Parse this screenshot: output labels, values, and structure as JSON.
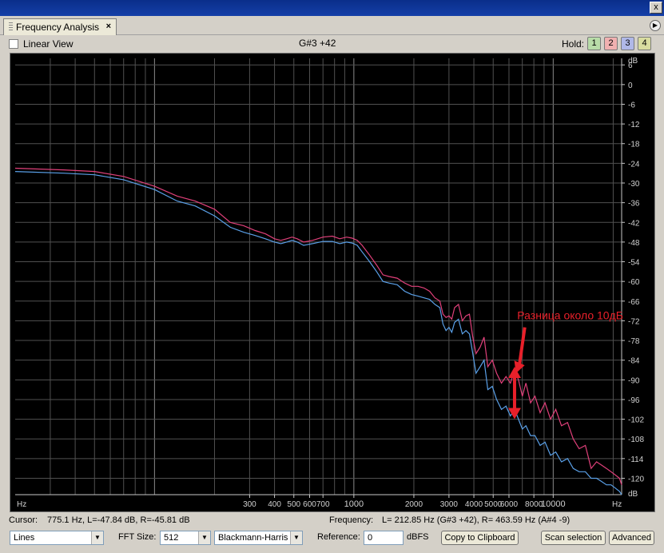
{
  "window": {
    "close_label": "x"
  },
  "tab": {
    "label": "Frequency Analysis",
    "close_label": "×"
  },
  "panel_menu_icon": "▶",
  "toolbar": {
    "linear_view_label": "Linear View",
    "linear_view_checked": false,
    "note": "G#3 +42",
    "hold_label": "Hold:",
    "hold_buttons": [
      {
        "label": "1",
        "color": "#b8dca8"
      },
      {
        "label": "2",
        "color": "#f0b0b0"
      },
      {
        "label": "3",
        "color": "#b0b8e8"
      },
      {
        "label": "4",
        "color": "#d8dca0"
      }
    ]
  },
  "chart_data": {
    "type": "line",
    "xscale": "log",
    "xlim": [
      20,
      22050
    ],
    "ylim": [
      -125,
      8
    ],
    "grid": true,
    "x_unit_label": "Hz",
    "y_unit_label": "dB",
    "x_ticks": [
      {
        "value": 300,
        "label": "300"
      },
      {
        "value": 400,
        "label": "400"
      },
      {
        "value": 500,
        "label": "500"
      },
      {
        "value": 600,
        "label": "600"
      },
      {
        "value": 700,
        "label": "700"
      },
      {
        "value": 1000,
        "label": "1000"
      },
      {
        "value": 2000,
        "label": "2000"
      },
      {
        "value": 3000,
        "label": "3000"
      },
      {
        "value": 4000,
        "label": "4000"
      },
      {
        "value": 5000,
        "label": "5000"
      },
      {
        "value": 6000,
        "label": "6000"
      },
      {
        "value": 8000,
        "label": "8000"
      },
      {
        "value": 10000,
        "label": "10000"
      }
    ],
    "x_gridlines": [
      30,
      40,
      50,
      60,
      70,
      80,
      90,
      100,
      200,
      300,
      400,
      500,
      600,
      700,
      800,
      900,
      1000,
      2000,
      3000,
      4000,
      5000,
      6000,
      7000,
      8000,
      9000,
      10000,
      20000
    ],
    "y_ticks": [
      6,
      0,
      -6,
      -12,
      -18,
      -24,
      -30,
      -36,
      -42,
      -48,
      -54,
      -60,
      -66,
      -72,
      -78,
      -84,
      -90,
      -96,
      -102,
      -108,
      -114,
      -120
    ],
    "series": [
      {
        "color": "#e0407a",
        "x": [
          20,
          35,
          50,
          70,
          100,
          130,
          160,
          200,
          240,
          280,
          320,
          360,
          400,
          430,
          460,
          490,
          520,
          560,
          620,
          700,
          780,
          850,
          920,
          980,
          1040,
          1100,
          1200,
          1300,
          1400,
          1500,
          1650,
          1800,
          1950,
          2100,
          2250,
          2400,
          2550,
          2700,
          2800,
          2900,
          3000,
          3100,
          3200,
          3350,
          3500,
          3650,
          3800,
          3950,
          4100,
          4300,
          4500,
          4700,
          4950,
          5200,
          5500,
          5800,
          6100,
          6400,
          6700,
          7000,
          7300,
          7700,
          8100,
          8600,
          9100,
          9700,
          10300,
          11000,
          11800,
          12600,
          13500,
          14500,
          15500,
          16500,
          17500,
          18500,
          19500,
          20500,
          21500,
          22050
        ],
        "y": [
          -25.5,
          -26,
          -26.5,
          -28,
          -31,
          -34,
          -35.5,
          -38,
          -42,
          -43,
          -44.5,
          -45.5,
          -47,
          -47.5,
          -47,
          -46.5,
          -47,
          -48,
          -47.5,
          -46.5,
          -46.2,
          -47,
          -46.5,
          -46.8,
          -47.5,
          -49,
          -52,
          -55,
          -58,
          -58.5,
          -59,
          -60.5,
          -61.5,
          -61.5,
          -62,
          -63,
          -65,
          -66,
          -70,
          -71,
          -70.5,
          -71.5,
          -68,
          -67,
          -72,
          -70.5,
          -70,
          -77,
          -82,
          -80,
          -77,
          -86,
          -84,
          -88,
          -91,
          -89,
          -91,
          -87,
          -90,
          -95,
          -91,
          -97,
          -95,
          -100,
          -97,
          -102,
          -99,
          -104,
          -103,
          -108,
          -111,
          -110,
          -117,
          -115,
          -116,
          -117,
          -118,
          -119,
          -120,
          -122
        ]
      },
      {
        "color": "#5aa0e8",
        "x": [
          20,
          35,
          50,
          70,
          100,
          130,
          160,
          200,
          240,
          280,
          320,
          360,
          400,
          430,
          460,
          490,
          520,
          560,
          620,
          700,
          780,
          850,
          920,
          980,
          1040,
          1100,
          1200,
          1300,
          1400,
          1500,
          1650,
          1800,
          1950,
          2100,
          2250,
          2400,
          2550,
          2700,
          2800,
          2900,
          3000,
          3100,
          3200,
          3350,
          3500,
          3650,
          3800,
          3950,
          4100,
          4300,
          4500,
          4700,
          4950,
          5200,
          5500,
          5800,
          6100,
          6400,
          6700,
          7000,
          7300,
          7700,
          8100,
          8600,
          9100,
          9700,
          10300,
          11000,
          11800,
          12600,
          13500,
          14500,
          15500,
          16500,
          17500,
          18500,
          19500,
          20500,
          21500,
          22050
        ],
        "y": [
          -26.5,
          -27,
          -27.5,
          -29,
          -32,
          -35.5,
          -37,
          -40,
          -43.5,
          -45,
          -46,
          -47,
          -48,
          -48.5,
          -48,
          -47.5,
          -48,
          -49,
          -48.5,
          -47.8,
          -47.8,
          -48.5,
          -48,
          -48.3,
          -49,
          -51,
          -54,
          -57,
          -60,
          -60.5,
          -61,
          -63,
          -64,
          -64.5,
          -65,
          -65.5,
          -67,
          -68,
          -73,
          -75,
          -74,
          -75.5,
          -72.5,
          -71.5,
          -76,
          -75,
          -76,
          -82,
          -88,
          -86,
          -84,
          -93,
          -92,
          -96,
          -99,
          -98,
          -101,
          -99,
          -102,
          -105,
          -104,
          -107,
          -107,
          -110,
          -109,
          -113,
          -112,
          -115,
          -114,
          -117,
          -118,
          -118,
          -120,
          -120,
          -121,
          -122,
          -122,
          -123,
          -124,
          -125
        ]
      }
    ],
    "annotations": [
      {
        "text": "Разница около 10дБ",
        "color": "#e8202a",
        "x": 6600,
        "y": -71.5
      },
      {
        "type": "double-arrow",
        "color": "#e8202a",
        "x": 6400,
        "y1": -87,
        "y2": -101
      },
      {
        "type": "pointer-arrow",
        "color": "#e8202a",
        "from_x": 7200,
        "from_y": -74,
        "to_x": 6500,
        "to_y": -88
      }
    ]
  },
  "status": {
    "cursor_label": "Cursor:",
    "cursor_value": "775.1 Hz, L=-47.84 dB, R=-45.81 dB",
    "frequency_label": "Frequency:",
    "frequency_value": "L= 212.85 Hz (G#3 +42), R= 463.59 Hz (A#4 -9)"
  },
  "controls": {
    "display_style": "Lines",
    "fft_size_label": "FFT Size:",
    "fft_size": "512",
    "window_function": "Blackmann-Harris",
    "reference_label": "Reference:",
    "reference_value": "0",
    "reference_unit": "dBFS",
    "copy_button": "Copy to Clipboard",
    "scan_button": "Scan selection",
    "advanced_button": "Advanced"
  }
}
